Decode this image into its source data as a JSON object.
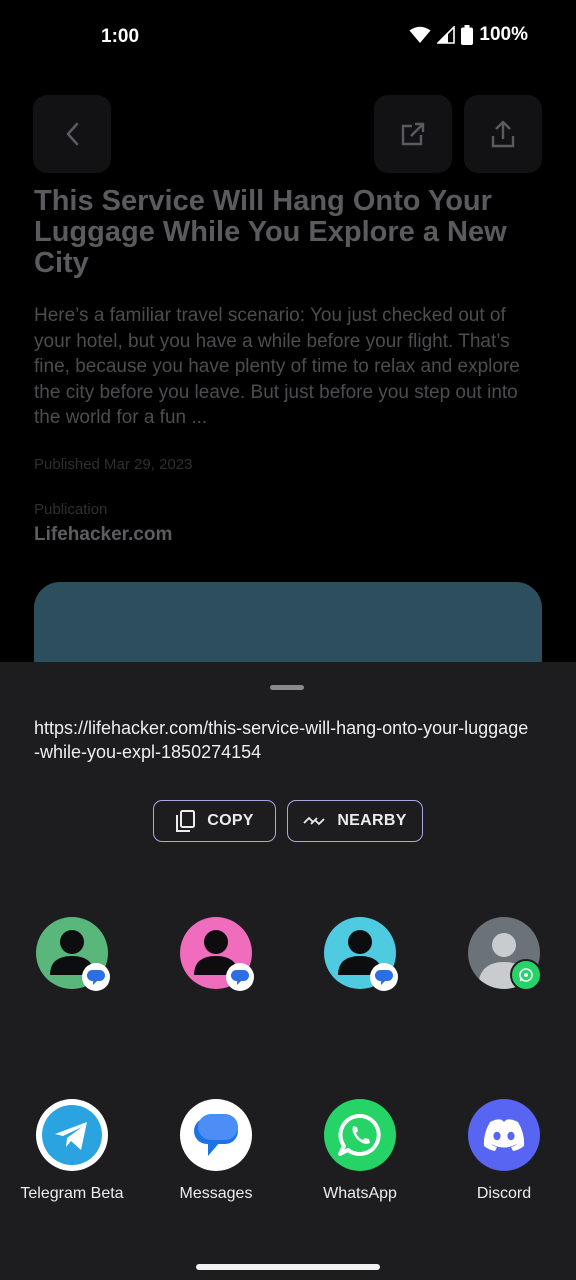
{
  "status_bar": {
    "time": "1:00",
    "battery": "100%"
  },
  "article": {
    "title": "This Service Will Hang Onto Your Luggage While You Explore a New City",
    "description": "Here’s a familiar travel scenario: You just checked out of your hotel, but you have a while before your flight. That’s fine, because you have plenty of time to relax and explore the city before you leave. But just before you step out into the world for a fun ...",
    "published": "Published Mar 29, 2023",
    "publication_label": "Publication",
    "publication_name": "Lifehacker.com"
  },
  "share_sheet": {
    "url": "https://lifehacker.com/this-service-will-hang-onto-your-luggage-while-you-expl-1850274154",
    "copy_label": "COPY",
    "nearby_label": "NEARBY",
    "apps": [
      {
        "label": "Telegram Beta"
      },
      {
        "label": "Messages"
      },
      {
        "label": "WhatsApp"
      },
      {
        "label": "Discord"
      }
    ]
  },
  "colors": {
    "sheet_bg": "#1d1d20",
    "chip_border": "#a9a8e4",
    "contact_green": "#5ab77c",
    "contact_pink": "#f06cbc",
    "contact_cyan": "#4ecbe0",
    "whatsapp": "#25d366",
    "discord": "#5865f2",
    "telegram": "#2aa3e0"
  }
}
